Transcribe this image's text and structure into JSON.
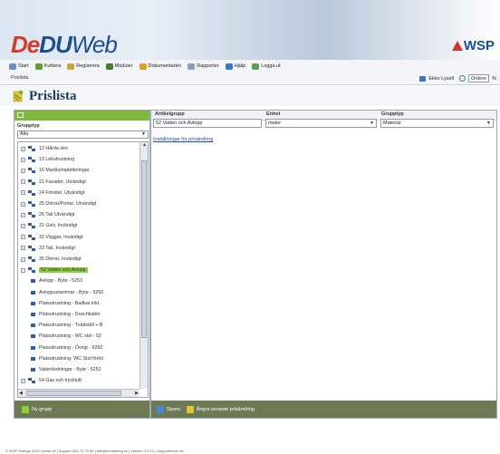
{
  "banner": {
    "logo_part1": "De",
    "logo_part2": "DU",
    "logo_part3": "Web",
    "brand": "WSP"
  },
  "menu": [
    {
      "label": "Start",
      "icon": "home-icon",
      "color": "#6a8fc4"
    },
    {
      "label": "Kvittera",
      "icon": "check-icon",
      "color": "#5da02f"
    },
    {
      "label": "Registrera",
      "icon": "register-icon",
      "color": "#caa43a"
    },
    {
      "label": "Moduler",
      "icon": "modules-icon",
      "color": "#4c7a2f"
    },
    {
      "label": "Dokumentarkiv",
      "icon": "archive-icon",
      "color": "#d8a326"
    },
    {
      "label": "Rapporter",
      "icon": "report-icon",
      "color": "#8aa0bd"
    },
    {
      "label": "Hjälp",
      "icon": "help-icon",
      "color": "#3a74c4"
    },
    {
      "label": "Logga ut",
      "icon": "logout-icon",
      "color": "#5ea04c"
    }
  ],
  "subbar": {
    "breadcrumb": "Prislista",
    "user_label": "Ekko Lysell",
    "select_value": "Ordere",
    "trailing": "%"
  },
  "page": {
    "title": "Prislista"
  },
  "left": {
    "group_label": "Grupptyp",
    "group_value": "Alla",
    "tree": [
      {
        "label": "12 Hårda stor",
        "level": 0
      },
      {
        "label": "13 Lekutrustning",
        "level": 0
      },
      {
        "label": "16 Markkompletteringar",
        "level": 0
      },
      {
        "label": "21 Fasader, Utvändigt",
        "level": 0
      },
      {
        "label": "24 Fönster, Utvändigt",
        "level": 0
      },
      {
        "label": "25 Dörrar/Portar, Utvändigt",
        "level": 0
      },
      {
        "label": "26 Tak Utvändigt",
        "level": 0
      },
      {
        "label": "31 Golv, Invändigt",
        "level": 0
      },
      {
        "label": "32 Väggar, Invändigt",
        "level": 0
      },
      {
        "label": "33 Tak, Invändigt",
        "level": 0
      },
      {
        "label": "35 Dörrar, Invändigt",
        "level": 0
      },
      {
        "label": "52 Vatten och Avlopp",
        "level": 0,
        "selected": true
      },
      {
        "label": "Avlopp - Byte - 5253",
        "level": 1
      },
      {
        "label": "Avloppsstammar - Byte - 5250",
        "level": 1
      },
      {
        "label": "Platsutrustning - Badkar inkl.",
        "level": 1
      },
      {
        "label": "Platsutrustning - Duschkabin",
        "level": 1
      },
      {
        "label": "Platsutrustning - Tvättställ + B",
        "level": 1
      },
      {
        "label": "Platsutrustning - WC stol - 52",
        "level": 1
      },
      {
        "label": "Platsutrustning - Övrigt - 5282",
        "level": 1
      },
      {
        "label": "Platsutrustning- WC Stol förhö",
        "level": 1
      },
      {
        "label": "Vattenledningar - Byte - 5252",
        "level": 1
      },
      {
        "label": "54 Gas och tryckluft",
        "level": 0
      }
    ],
    "footer_label": "Ny grupp"
  },
  "right": {
    "artikelgrupp_label": "Artikelgrupp",
    "artikelgrupp_value": "52 Vatten och Avlopp",
    "enhet_label": "Enhet",
    "enhet_value": "meter",
    "grupptyp_label": "Grupptyp",
    "grupptyp_value": "Material",
    "link_text": "Inställningar för prisändring",
    "save_label": "Spara",
    "undo_label": "Ångra senaste prisändring"
  },
  "status_line": "© WSP Sverige 2010 | Antal 18 | Support 000-70 70 00 | info@forvaltning.se | Version 4.0.12 | Supportforum.se"
}
